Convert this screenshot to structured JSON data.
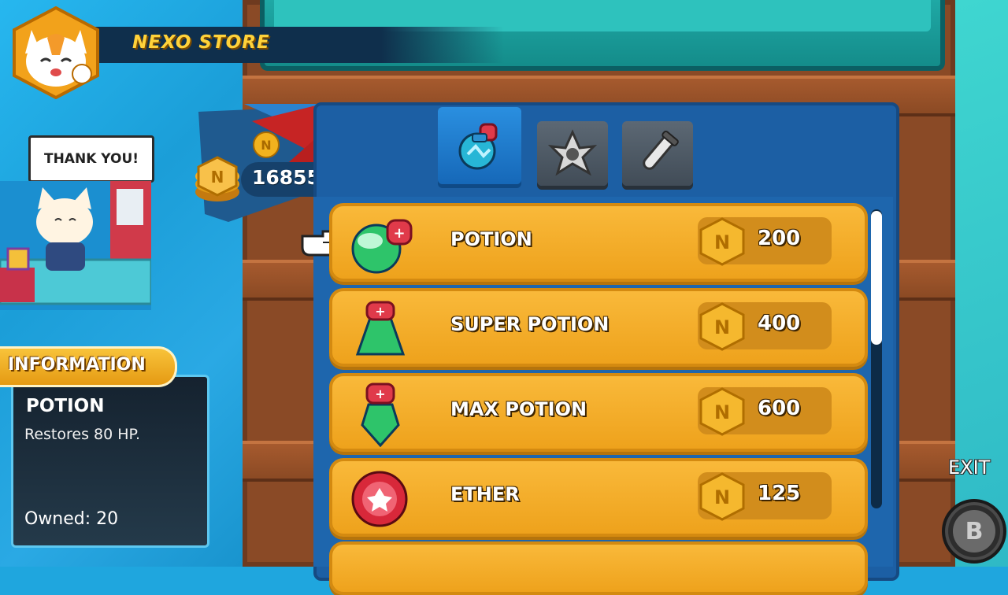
{
  "header": {
    "title": "NEXO STORE"
  },
  "shopkeeper": {
    "speech": "THANK YOU!"
  },
  "wallet": {
    "balance": "16855",
    "currency_icon": "nexo-coin-icon"
  },
  "tabs": [
    {
      "label": "potions",
      "icon": "potion-flask-icon",
      "active": true
    },
    {
      "label": "items",
      "icon": "shuriken-icon",
      "active": false
    },
    {
      "label": "tools",
      "icon": "test-tube-icon",
      "active": false
    }
  ],
  "items": [
    {
      "name": "POTION",
      "price": "200",
      "icon": "round-potion-icon",
      "selected": true
    },
    {
      "name": "SUPER POTION",
      "price": "400",
      "icon": "flask-potion-icon",
      "selected": false
    },
    {
      "name": "MAX POTION",
      "price": "600",
      "icon": "crystal-potion-icon",
      "selected": false
    },
    {
      "name": "ETHER",
      "price": "125",
      "icon": "ether-orb-icon",
      "selected": false
    }
  ],
  "information": {
    "heading": "INFORMATION",
    "item_name": "POTION",
    "description": "Restores 80 HP.",
    "owned": "Owned: 20"
  },
  "exit": {
    "label": "EXIT",
    "button": "B"
  },
  "colors": {
    "row_fill": "#f9b93a",
    "panel": "#1c5fa4",
    "title": "#ffd23a",
    "coin": "#f6b22c"
  }
}
